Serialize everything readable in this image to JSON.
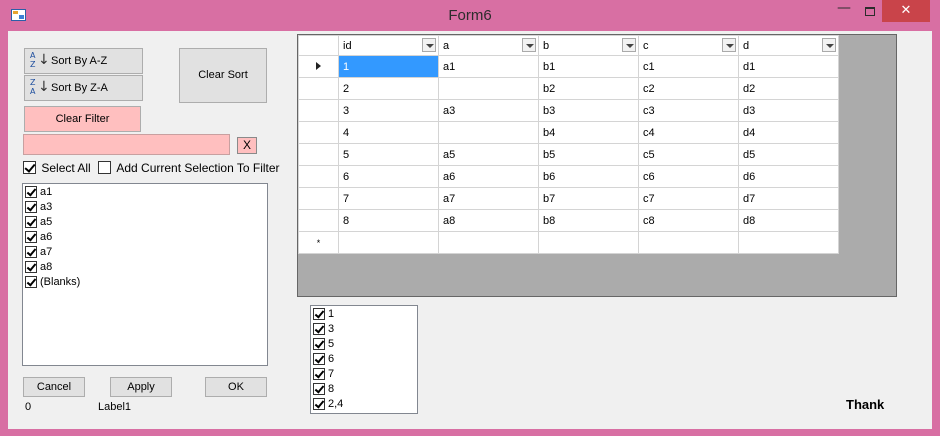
{
  "window": {
    "title": "Form6",
    "minimize_glyph": "—",
    "close_glyph": "✕"
  },
  "sort": {
    "az_label": "Sort By A-Z",
    "za_label": "Sort By Z-A",
    "clear_sort_label": "Clear Sort",
    "az_icon": {
      "top": "A",
      "bottom": "Z",
      "arrow": "↓"
    },
    "za_icon": {
      "top": "Z",
      "bottom": "A",
      "arrow": "↓"
    }
  },
  "filter": {
    "clear_filter_label": "Clear Filter",
    "search_value": "",
    "clear_search_label": "X",
    "select_all_label": "Select All",
    "select_all_checked": true,
    "add_selection_label": "Add Current Selection To Filter",
    "add_selection_checked": false,
    "items": [
      {
        "label": "a1",
        "checked": true
      },
      {
        "label": "a3",
        "checked": true
      },
      {
        "label": "a5",
        "checked": true
      },
      {
        "label": "a6",
        "checked": true
      },
      {
        "label": "a7",
        "checked": true
      },
      {
        "label": "a8",
        "checked": true
      },
      {
        "label": "(Blanks)",
        "checked": true
      }
    ]
  },
  "actions": {
    "cancel_label": "Cancel",
    "apply_label": "Apply",
    "ok_label": "OK"
  },
  "status": {
    "count": "0",
    "label1": "Label1"
  },
  "grid": {
    "columns": [
      "id",
      "a",
      "b",
      "c",
      "d"
    ],
    "rows": [
      [
        "1",
        "a1",
        "b1",
        "c1",
        "d1"
      ],
      [
        "2",
        "",
        "b2",
        "c2",
        "d2"
      ],
      [
        "3",
        "a3",
        "b3",
        "c3",
        "d3"
      ],
      [
        "4",
        "",
        "b4",
        "c4",
        "d4"
      ],
      [
        "5",
        "a5",
        "b5",
        "c5",
        "d5"
      ],
      [
        "6",
        "a6",
        "b6",
        "c6",
        "d6"
      ],
      [
        "7",
        "a7",
        "b7",
        "c7",
        "d7"
      ],
      [
        "8",
        "a8",
        "b8",
        "c8",
        "d8"
      ]
    ],
    "new_row_glyph": "*",
    "selected_row": 0,
    "selected_col": 0
  },
  "id_list": {
    "items": [
      {
        "label": "1",
        "checked": true
      },
      {
        "label": "3",
        "checked": true
      },
      {
        "label": "5",
        "checked": true
      },
      {
        "label": "6",
        "checked": true
      },
      {
        "label": "7",
        "checked": true
      },
      {
        "label": "8",
        "checked": true
      },
      {
        "label": "2,4",
        "checked": true
      }
    ]
  },
  "footer": {
    "thank_text": "Thank"
  }
}
